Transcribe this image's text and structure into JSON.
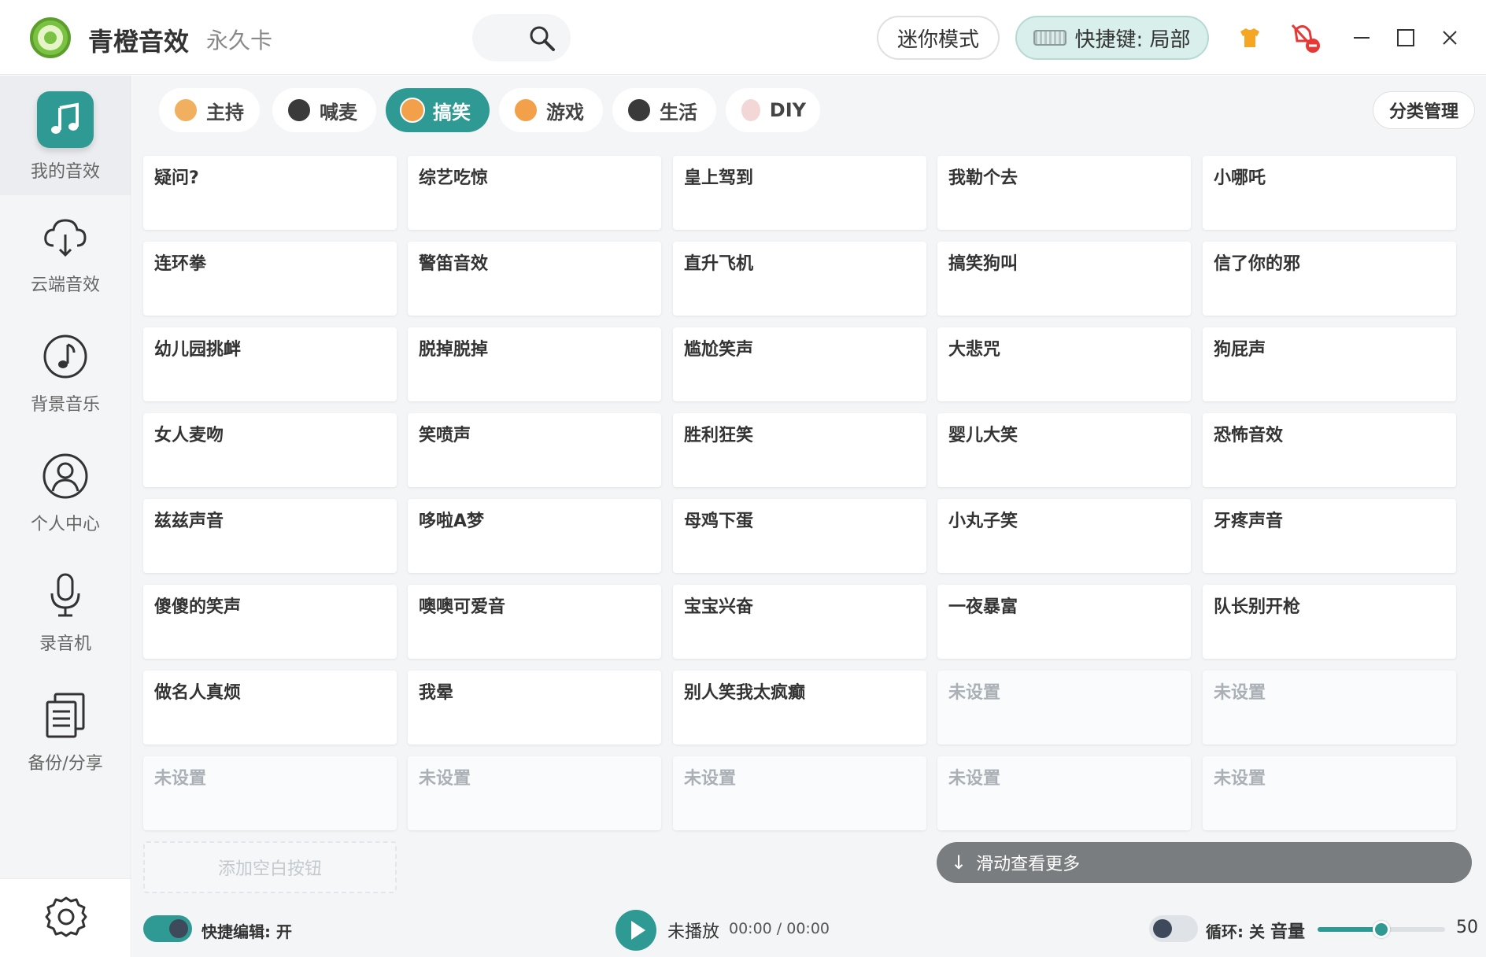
{
  "titlebar": {
    "app_name": "青橙音效",
    "license": "永久卡",
    "mini_mode": "迷你模式",
    "hotkey": "快捷键: 局部"
  },
  "sidebar": {
    "items": [
      {
        "label": "我的音效",
        "icon": "music-note-icon",
        "active": true
      },
      {
        "label": "云端音效",
        "icon": "cloud-download-icon"
      },
      {
        "label": "背景音乐",
        "icon": "music-circle-icon"
      },
      {
        "label": "个人中心",
        "icon": "user-icon"
      },
      {
        "label": "录音机",
        "icon": "microphone-icon"
      },
      {
        "label": "备份/分享",
        "icon": "documents-icon"
      }
    ],
    "settings_icon": "gear-icon"
  },
  "categories": {
    "tabs": [
      {
        "label": "主持",
        "icon": "dog-face-icon"
      },
      {
        "label": "喊麦",
        "icon": "husky-face-icon"
      },
      {
        "label": "搞笑",
        "icon": "shiba-face-icon",
        "active": true
      },
      {
        "label": "游戏",
        "icon": "shiba-face-icon"
      },
      {
        "label": "生活",
        "icon": "husky-face-icon"
      },
      {
        "label": "DIY",
        "icon": "cat-face-icon"
      }
    ],
    "manage": "分类管理"
  },
  "sounds": [
    "疑问?",
    "综艺吃惊",
    "皇上驾到",
    "我勒个去",
    "小哪吒",
    "连环拳",
    "警笛音效",
    "直升飞机",
    "搞笑狗叫",
    "信了你的邪",
    "幼儿园挑衅",
    "脱掉脱掉",
    "尴尬笑声",
    "大悲咒",
    "狗屁声",
    "女人麦吻",
    "笑喷声",
    "胜利狂笑",
    "婴儿大笑",
    "恐怖音效",
    "兹兹声音",
    "哆啦A梦",
    "母鸡下蛋",
    "小丸子笑",
    "牙疼声音",
    "傻傻的笑声",
    "噢噢可爱音",
    "宝宝兴奋",
    "一夜暴富",
    "队长别开枪",
    "做名人真烦",
    "我晕",
    "别人笑我太疯癫",
    "未设置",
    "未设置",
    "未设置",
    "未设置",
    "未设置",
    "未设置",
    "未设置"
  ],
  "empty_label": "未设置",
  "add_blank": "添加空白按钮",
  "scroll_more": "滑动查看更多",
  "footer": {
    "quick_edit": "快捷编辑: 开",
    "status": "未播放",
    "time": "00:00 / 00:00",
    "loop": "循环: 关",
    "volume_label": "音量",
    "volume_value": "50"
  },
  "colors": {
    "accent": "#2f9a93",
    "sidebar_bg": "#f4f5f7",
    "main_bg": "#f3f5f7"
  }
}
